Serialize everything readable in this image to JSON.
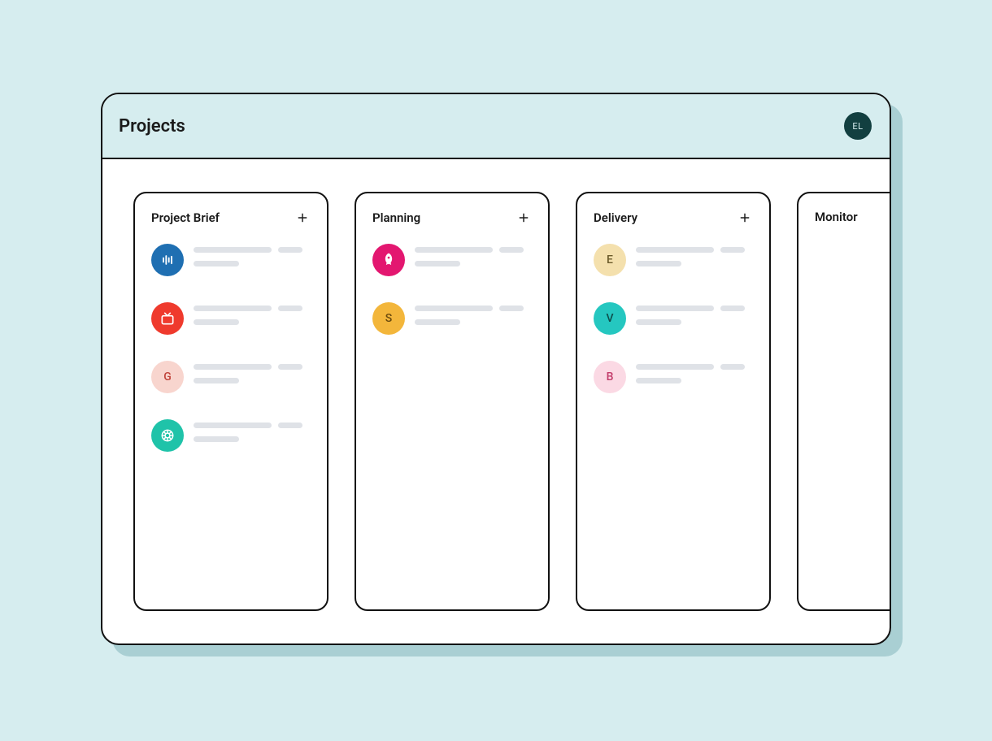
{
  "header": {
    "title": "Projects",
    "user_initials": "EL"
  },
  "columns": [
    {
      "title": "Project Brief",
      "has_add": true,
      "cards": [
        {
          "kind": "icon",
          "icon": "audio-icon",
          "bg": "#1f6fb2"
        },
        {
          "kind": "icon",
          "icon": "tv-icon",
          "bg": "#ef3a2d"
        },
        {
          "kind": "letter",
          "letter": "G",
          "bg": "#f8d5ce",
          "fg": "#c0433a"
        },
        {
          "kind": "icon",
          "icon": "aperture-icon",
          "bg": "#1fc3a9"
        }
      ]
    },
    {
      "title": "Planning",
      "has_add": true,
      "cards": [
        {
          "kind": "icon",
          "icon": "rocket-icon",
          "bg": "#e31770"
        },
        {
          "kind": "letter",
          "letter": "S",
          "bg": "#f3b63b",
          "fg": "#6a4a0d"
        }
      ]
    },
    {
      "title": "Delivery",
      "has_add": true,
      "cards": [
        {
          "kind": "letter",
          "letter": "E",
          "bg": "#f4e0ad",
          "fg": "#6a5a2a"
        },
        {
          "kind": "letter",
          "letter": "V",
          "bg": "#25c7c0",
          "fg": "#0e4f4c"
        },
        {
          "kind": "letter",
          "letter": "B",
          "bg": "#fbd9e4",
          "fg": "#c23a69"
        }
      ]
    },
    {
      "title": "Monitor",
      "has_add": false,
      "cards": []
    }
  ]
}
